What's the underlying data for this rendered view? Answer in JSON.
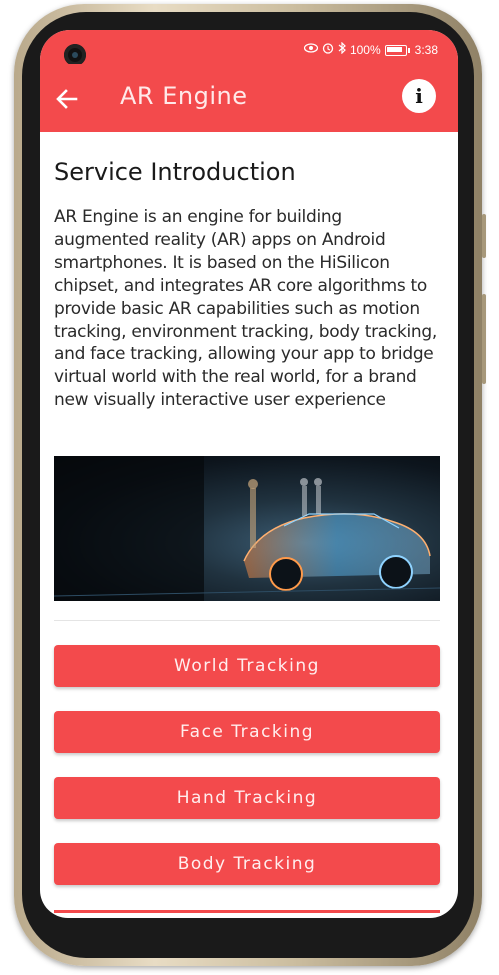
{
  "status_bar": {
    "battery_percent": "100%",
    "time": "3:38",
    "icons": [
      "eye-icon",
      "alarm-icon",
      "bluetooth-icon",
      "battery-icon"
    ]
  },
  "app_bar": {
    "title": "AR Engine",
    "back_icon": "arrow-left-icon",
    "info_label": "i"
  },
  "intro": {
    "heading": "Service Introduction",
    "body": "AR Engine is an engine for building augmented reality (AR) apps on Android smartphones. It is based on the HiSilicon chipset, and integrates AR core algorithms to provide basic AR capabilities such as motion tracking, environment tracking, body tracking, and face tracking, allowing your app to bridge virtual world with the real world, for a brand new visually interactive user experience"
  },
  "buttons": [
    {
      "label": "World Tracking"
    },
    {
      "label": "Face Tracking"
    },
    {
      "label": "Hand Tracking"
    },
    {
      "label": "Body Tracking"
    }
  ],
  "colors": {
    "accent": "#f34a4c",
    "text": "#1a1a1a"
  }
}
